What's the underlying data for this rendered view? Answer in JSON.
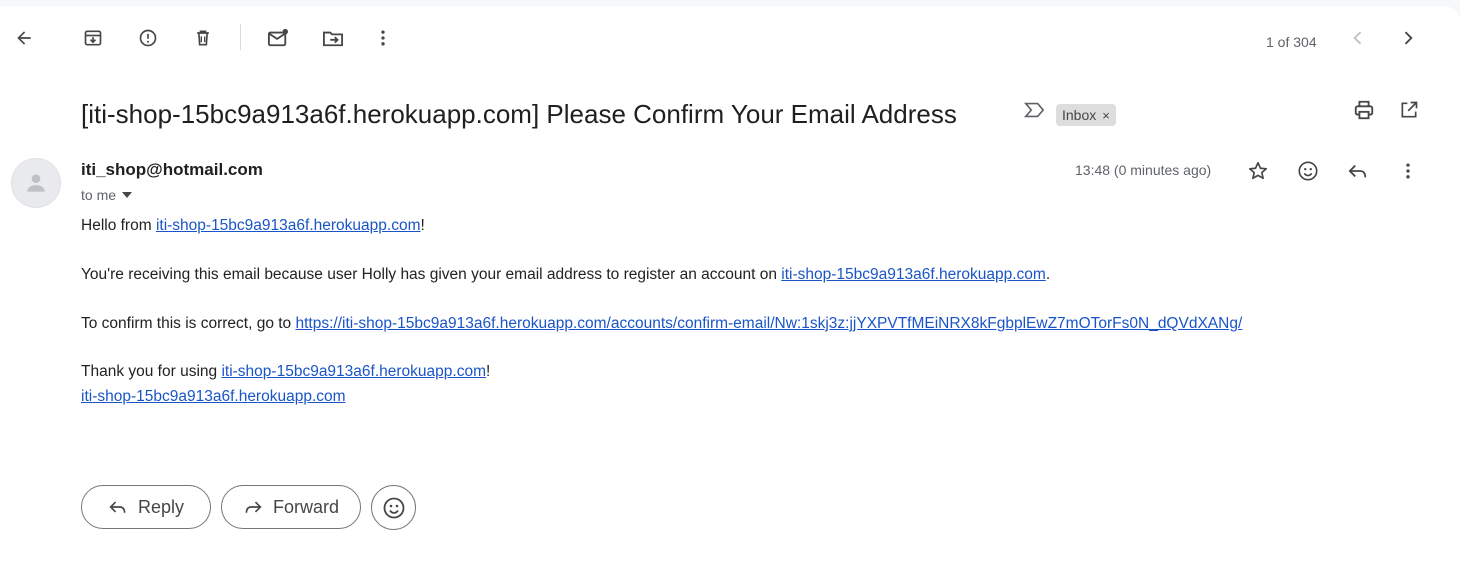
{
  "toolbar": {
    "back_icon": "arrow-left-icon",
    "archive_icon": "archive-icon",
    "spam_icon": "report-spam-icon",
    "delete_icon": "trash-icon",
    "unread_icon": "mark-unread-icon",
    "move_icon": "move-to-folder-icon",
    "more_icon": "more-vertical-icon",
    "pagination": "1 of 304",
    "prev_icon": "chevron-left-icon",
    "next_icon": "chevron-right-icon"
  },
  "email": {
    "subject": "[iti-shop-15bc9a913a6f.herokuapp.com] Please Confirm Your Email Address",
    "label": "Inbox",
    "label_remove": "×",
    "sender": "iti_shop@hotmail.com",
    "recipient": "to me",
    "timestamp": "13:48 (0 minutes ago)",
    "body": {
      "line1_prefix": "Hello from ",
      "line1_link": "iti-shop-15bc9a913a6f.herokuapp.com",
      "line1_suffix": "!",
      "line2_prefix": "You're receiving this email because user Holly has given your email address to register an account on ",
      "line2_link": "iti-shop-15bc9a913a6f.herokuapp.com",
      "line2_suffix": ".",
      "line3_prefix": "To confirm this is correct, go to ",
      "line3_link": "https://iti-shop-15bc9a913a6f.herokuapp.com/accounts/confirm-email/Nw:1skj3z:jjYXPVTfMEiNRX8kFgbplEwZ7mOTorFs0N_dQVdXANg/",
      "line4_prefix": "Thank you for using ",
      "line4_link": "iti-shop-15bc9a913a6f.herokuapp.com",
      "line4_suffix": "!",
      "line5_link": "iti-shop-15bc9a913a6f.herokuapp.com"
    }
  },
  "actions": {
    "reply": "Reply",
    "forward": "Forward"
  }
}
